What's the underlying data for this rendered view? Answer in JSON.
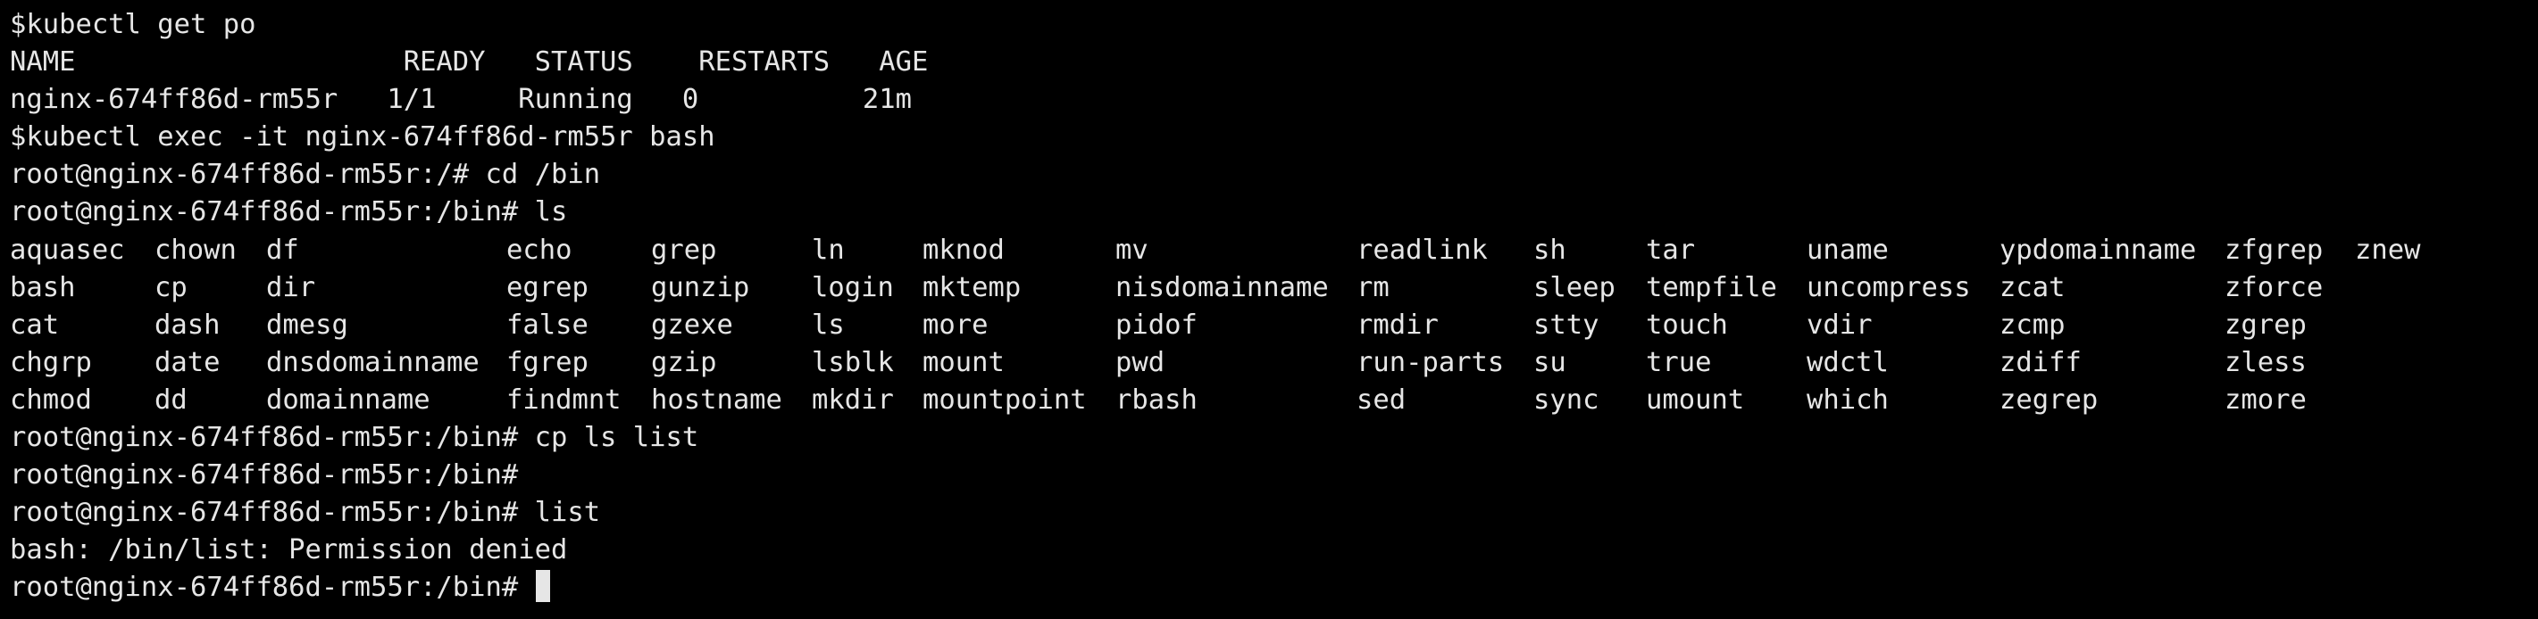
{
  "terminal": {
    "lines_before": [
      "$kubectl get po",
      "NAME                    READY   STATUS    RESTARTS   AGE",
      "nginx-674ff86d-rm55r   1/1     Running   0          21m",
      "$kubectl exec -it nginx-674ff86d-rm55r bash",
      "root@nginx-674ff86d-rm55r:/# cd /bin",
      "root@nginx-674ff86d-rm55r:/bin# ls"
    ],
    "ls_rows": [
      [
        "aquasec",
        "chown",
        "df",
        "echo",
        "grep",
        "ln",
        "mknod",
        "mv",
        "readlink",
        "sh",
        "tar",
        "uname",
        "ypdomainname",
        "zfgrep",
        "znew"
      ],
      [
        "bash",
        "cp",
        "dir",
        "egrep",
        "gunzip",
        "login",
        "mktemp",
        "nisdomainname",
        "rm",
        "sleep",
        "tempfile",
        "uncompress",
        "zcat",
        "zforce",
        ""
      ],
      [
        "cat",
        "dash",
        "dmesg",
        "false",
        "gzexe",
        "ls",
        "more",
        "pidof",
        "rmdir",
        "stty",
        "touch",
        "vdir",
        "zcmp",
        "zgrep",
        ""
      ],
      [
        "chgrp",
        "date",
        "dnsdomainname",
        "fgrep",
        "gzip",
        "lsblk",
        "mount",
        "pwd",
        "run-parts",
        "su",
        "true",
        "wdctl",
        "zdiff",
        "zless",
        ""
      ],
      [
        "chmod",
        "dd",
        "domainname",
        "findmnt",
        "hostname",
        "mkdir",
        "mountpoint",
        "rbash",
        "sed",
        "sync",
        "umount",
        "which",
        "zegrep",
        "zmore",
        ""
      ]
    ],
    "lines_after": [
      "root@nginx-674ff86d-rm55r:/bin# cp ls list",
      "root@nginx-674ff86d-rm55r:/bin#",
      "root@nginx-674ff86d-rm55r:/bin# list",
      "bash: /bin/list: Permission denied"
    ],
    "prompt": "root@nginx-674ff86d-rm55r:/bin# "
  }
}
